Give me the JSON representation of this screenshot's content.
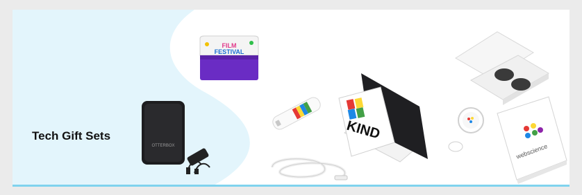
{
  "section": {
    "title": "Tech Gift Sets",
    "accent_color": "#7fd3ee",
    "background_tint": "#e3f5fc"
  },
  "products": {
    "speaker": {
      "brand_line_1": "FILM",
      "brand_line_2": "FESTIVAL",
      "accent": "#6a2cc4"
    },
    "power_bank": {
      "brand": "OTTERBOX"
    },
    "phone_stand": {
      "brand": "KIND"
    },
    "earbuds_kit": {
      "brand": "webscience"
    }
  }
}
